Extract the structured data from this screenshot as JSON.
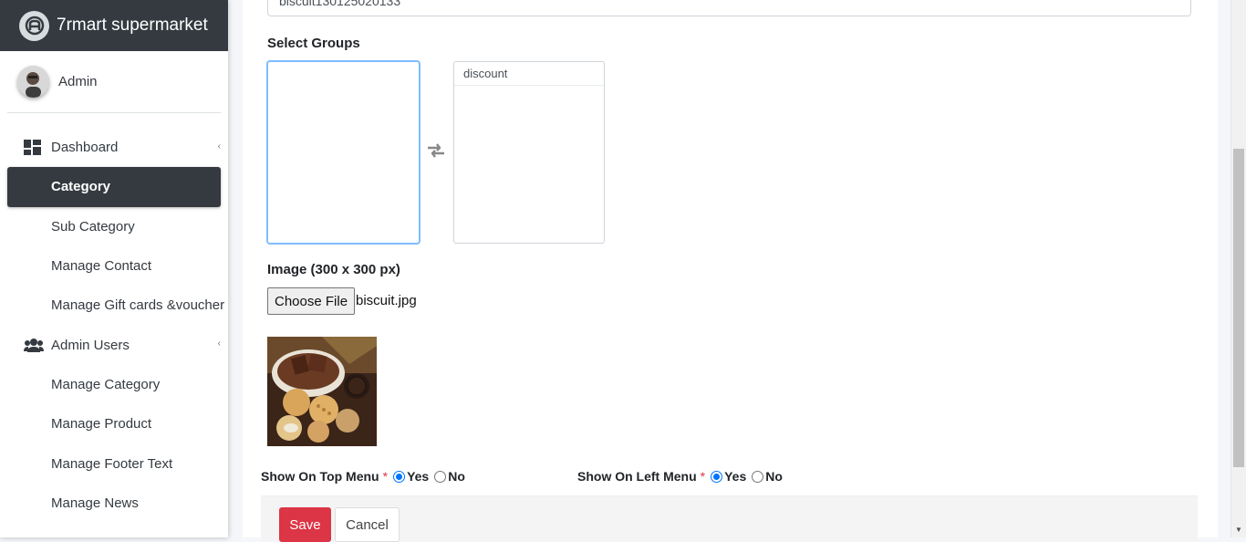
{
  "brand": {
    "title": "7rmart supermarket"
  },
  "user": {
    "name": "Admin"
  },
  "sidebar": {
    "items": [
      {
        "label": "Dashboard",
        "icon": "dashboard-icon"
      },
      {
        "label": "Category"
      },
      {
        "label": "Sub Category"
      },
      {
        "label": "Manage Contact"
      },
      {
        "label": "Manage Gift cards &voucher"
      },
      {
        "label": "Admin Users",
        "icon": "users-icon"
      },
      {
        "label": "Manage Category"
      },
      {
        "label": "Manage Product"
      },
      {
        "label": "Manage Footer Text"
      },
      {
        "label": "Manage News"
      }
    ]
  },
  "form": {
    "code_value": "biscuit130125020133",
    "select_groups_label": "Select Groups",
    "groups_selected": "discount",
    "image_label": "Image (300 x 300 px)",
    "choose_file_label": "Choose File",
    "file_name": "biscuit.jpg",
    "top_menu_label": "Show On Top Menu",
    "left_menu_label": "Show On Left Menu",
    "required_mark": "*",
    "yes_label": "Yes",
    "no_label": "No",
    "top_menu_value": "Yes",
    "left_menu_value": "Yes"
  },
  "actions": {
    "save_label": "Save",
    "cancel_label": "Cancel"
  },
  "colors": {
    "sidebar_dark": "#343a40",
    "save_red": "#dc3545",
    "radio_blue": "#0075ff"
  }
}
